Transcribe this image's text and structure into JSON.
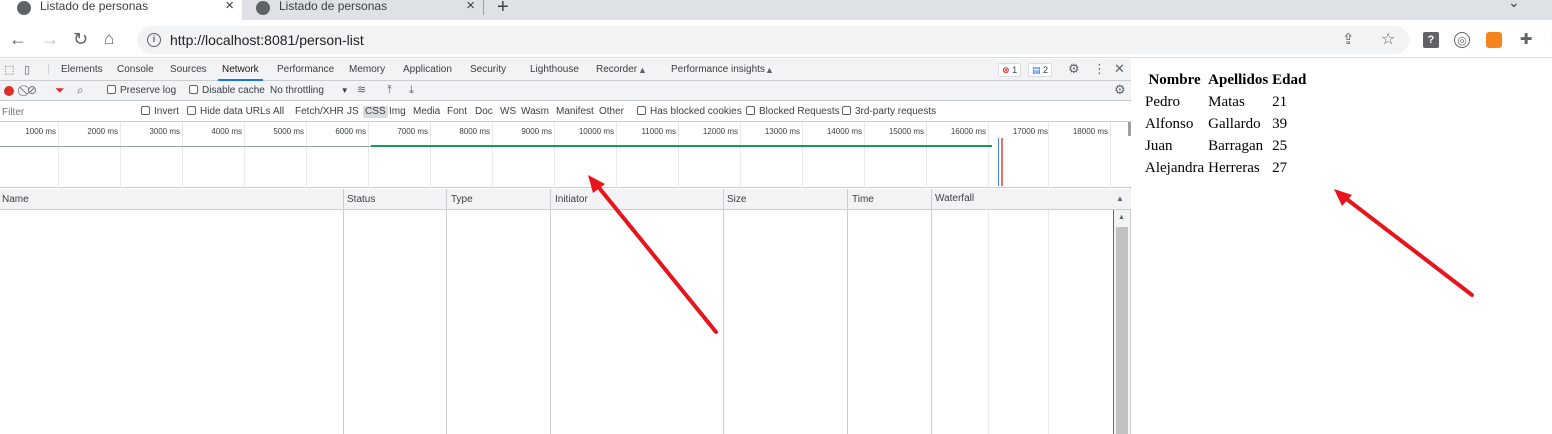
{
  "browser": {
    "tabs": [
      {
        "title": "Listado de personas",
        "active": true
      },
      {
        "title": "Listado de personas",
        "active": false
      }
    ],
    "url": "http://localhost:8081/person-list"
  },
  "devtools": {
    "panels": [
      "Elements",
      "Console",
      "Sources",
      "Network",
      "Performance",
      "Memory",
      "Application",
      "Security",
      "Lighthouse",
      "Recorder",
      "Performance insights"
    ],
    "active_panel": "Network",
    "error_count": "1",
    "message_count": "2",
    "toolbar": {
      "preserve_log": "Preserve log",
      "disable_cache": "Disable cache",
      "throttling": "No throttling"
    },
    "filter_bar": {
      "filter_placeholder": "Filter",
      "invert": "Invert",
      "hide_data_urls": "Hide data URLs",
      "types": [
        "All",
        "Fetch/XHR",
        "JS",
        "CSS",
        "Img",
        "Media",
        "Font",
        "Doc",
        "WS",
        "Wasm",
        "Manifest",
        "Other"
      ],
      "selected_type": "CSS",
      "has_blocked_cookies": "Has blocked cookies",
      "blocked_requests": "Blocked Requests",
      "third_party": "3rd-party requests"
    },
    "overview_ticks": [
      "1000 ms",
      "2000 ms",
      "3000 ms",
      "4000 ms",
      "5000 ms",
      "6000 ms",
      "7000 ms",
      "8000 ms",
      "9000 ms",
      "10000 ms",
      "11000 ms",
      "12000 ms",
      "13000 ms",
      "14000 ms",
      "15000 ms",
      "16000 ms",
      "17000 ms",
      "18000 ms"
    ],
    "columns": [
      "Name",
      "Status",
      "Type",
      "Initiator",
      "Size",
      "Time",
      "Waterfall"
    ]
  },
  "page": {
    "table": {
      "headers": [
        "Nombre",
        "Apellidos",
        "Edad"
      ],
      "rows": [
        [
          "Pedro",
          "Matas",
          "21"
        ],
        [
          "Alfonso",
          "Gallardo",
          "39"
        ],
        [
          "Juan",
          "Barragan",
          "25"
        ],
        [
          "Alejandra",
          "Herreras",
          "27"
        ]
      ]
    }
  },
  "colors": {
    "devtools_accent": "#1a73e8",
    "record": "#d93025",
    "timeline_green": "#0f9d58",
    "annotation_arrow": "#e8141b"
  }
}
